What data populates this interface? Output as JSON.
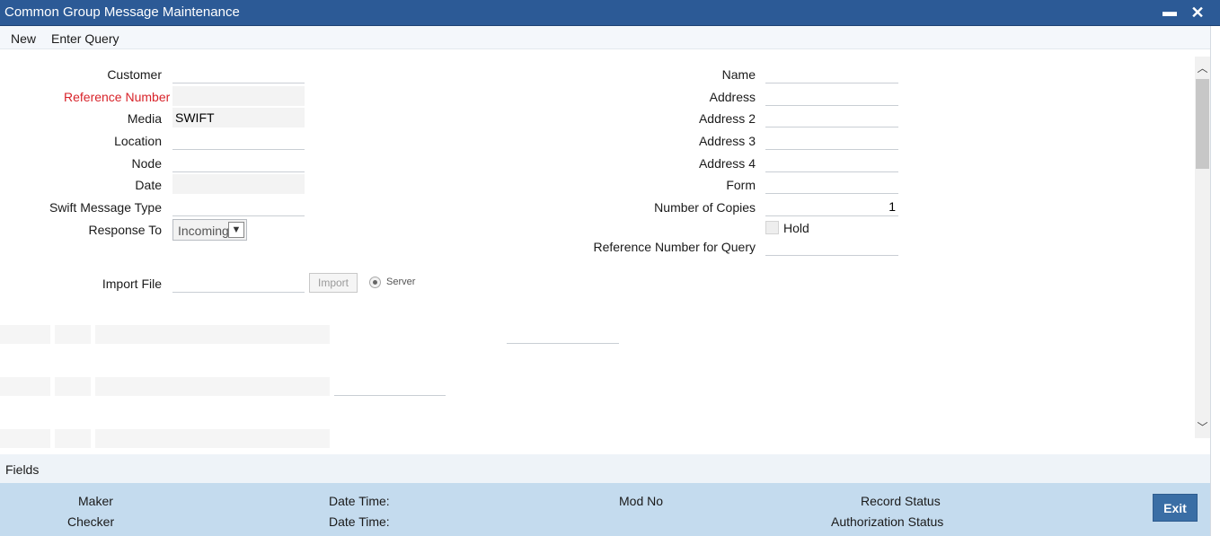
{
  "window": {
    "title": "Common Group Message Maintenance",
    "minimize_icon": "minus-icon",
    "close_icon": "close-icon"
  },
  "menu": {
    "new": "New",
    "enter_query": "Enter Query"
  },
  "left_form": {
    "customer": {
      "label": "Customer",
      "value": ""
    },
    "reference_number": {
      "label": "Reference Number",
      "required_mark": "*",
      "value": ""
    },
    "media": {
      "label": "Media",
      "value": "SWIFT"
    },
    "location": {
      "label": "Location",
      "value": ""
    },
    "node": {
      "label": "Node",
      "value": ""
    },
    "date": {
      "label": "Date",
      "value": ""
    },
    "swift_message_type": {
      "label": "Swift Message Type",
      "value": ""
    },
    "response_to": {
      "label": "Response To",
      "value": "Incoming"
    }
  },
  "right_form": {
    "name": {
      "label": "Name",
      "value": ""
    },
    "address": {
      "label": "Address",
      "value": ""
    },
    "address2": {
      "label": "Address 2",
      "value": ""
    },
    "address3": {
      "label": "Address 3",
      "value": ""
    },
    "address4": {
      "label": "Address 4",
      "value": ""
    },
    "form": {
      "label": "Form",
      "value": ""
    },
    "number_of_copies": {
      "label": "Number of Copies",
      "value": "1"
    },
    "hold": {
      "label": "Hold",
      "checked": false
    },
    "reference_number_for_query": {
      "label": "Reference Number for Query",
      "value": ""
    }
  },
  "import": {
    "label": "Import File",
    "value": "",
    "button": "Import",
    "radio_label": "Server",
    "radio_selected": true
  },
  "fields_bar": {
    "label": "Fields"
  },
  "footer": {
    "maker": "Maker",
    "checker": "Checker",
    "date_time_1": "Date Time:",
    "date_time_2": "Date Time:",
    "mod_no": "Mod No",
    "record_status": "Record Status",
    "authorization_status": "Authorization Status",
    "exit": "Exit"
  },
  "colors": {
    "titlebar": "#2c5a96",
    "required": "#d8232a",
    "footer": "#c4dbee",
    "exit_button": "#3a6ea5"
  }
}
